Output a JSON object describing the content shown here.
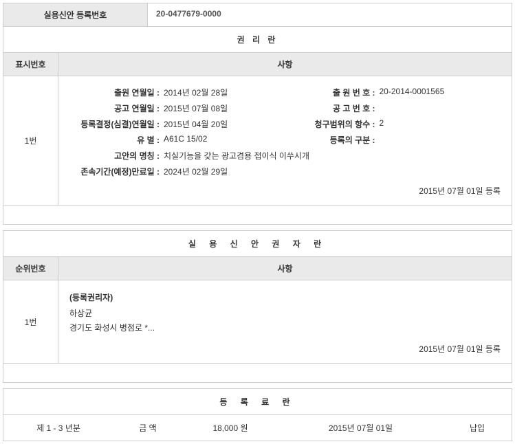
{
  "header": {
    "label": "실용신안 등록번호",
    "value": "20-0477679-0000"
  },
  "rights_section": {
    "title": "권 리 란",
    "col_left": "표시번호",
    "col_right": "사항",
    "row_id": "1번",
    "details": {
      "app_date_label": "출원 연월일 :",
      "app_date_value": "2014년 02월 28일",
      "app_no_label": "출 원 번 호 :",
      "app_no_value": "20-2014-0001565",
      "pub_date_label": "공고 연월일 :",
      "pub_date_value": "2015년 07월 08일",
      "pub_no_label": "공 고 번 호 :",
      "pub_no_value": "",
      "reg_decision_label": "등록결정(심결)연월일 :",
      "reg_decision_value": "2015년 04월 20일",
      "claim_count_label": "청구범위의 항수 :",
      "claim_count_value": "2",
      "type_label": "유 별 :",
      "type_value": "A61C 15/02",
      "reg_class_label": "등록의 구분 :",
      "reg_class_value": "",
      "invention_label": "고안의 명칭 :",
      "invention_value": "치실기능을 갖는 광고겸용 접이식 이쑤시개",
      "duration_label": "존속기간(예정)만료일 :",
      "duration_value": "2024년 02월 29일"
    },
    "reg_date": "2015년 07월 01일 등록"
  },
  "holder_section": {
    "title": "실 용 신 안 권 자 란",
    "col_left": "순위번호",
    "col_right": "사항",
    "row_id": "1번",
    "holder_title": "(등록권리자)",
    "holder_name": "하상균",
    "holder_address": "경기도 화성시 병점로 *...",
    "reg_date": "2015년 07월 01일 등록"
  },
  "fee_section": {
    "title": "등 록 료 란",
    "period": "제 1 - 3 년분",
    "amount_label": "금 액",
    "amount_value": "18,000 원",
    "date": "2015년 07월 01일",
    "status": "납입"
  }
}
